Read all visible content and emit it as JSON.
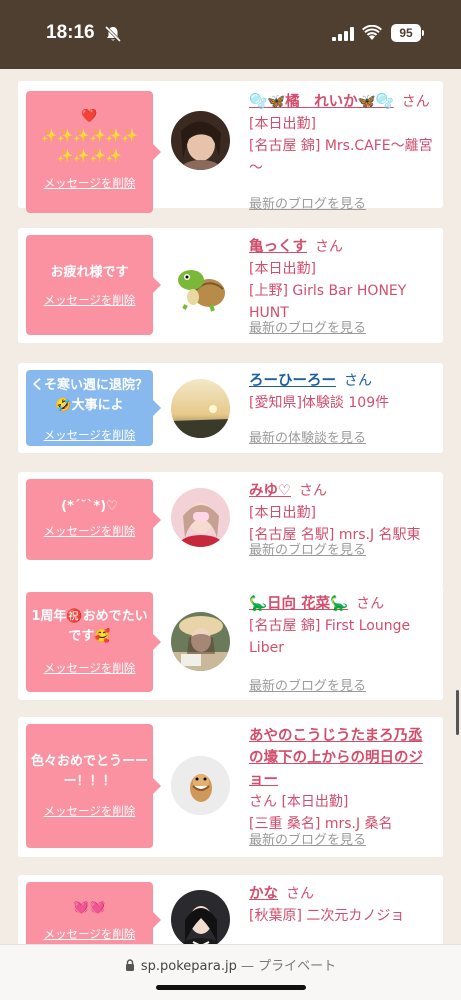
{
  "status_bar": {
    "time": "18:16",
    "battery": "95"
  },
  "url_bar": {
    "domain": "sp.pokepara.jp",
    "separator": "—",
    "mode": "プライベート"
  },
  "cards": [
    {
      "message": "❤️\n✨✨✨✨✨✨\n✨✨✨✨",
      "delete": "メッセージを削除",
      "name": "🫧🦋橘　れいか🦋🫧",
      "san": "さん",
      "detail": "[本日出勤]\n[名古屋 錦] Mrs.CAFE～離宮～",
      "link": "最新のブログを見る"
    },
    {
      "message": "お疲れ様です",
      "delete": "メッセージを削除",
      "name": "亀っくす",
      "san": "さん",
      "detail": "[本日出勤]\n[上野] Girls Bar HONEY HUNT",
      "link": "最新のブログを見る"
    },
    {
      "message": "くそ寒い週に退院？🤣大事によ",
      "delete": "メッセージを削除",
      "name": "ろーひーろー",
      "san": "さん",
      "detail": "[愛知県]体験談 109件",
      "link": "最新の体験談を見る"
    },
    {
      "message": "(*´˘`*)♡",
      "delete": "メッセージを削除",
      "name": "みゆ♡",
      "san": "さん",
      "detail": "[本日出勤]\n[名古屋 名駅] mrs.J 名駅東",
      "link": "最新のブログを見る"
    },
    {
      "message": "1周年㊗️おめでたいです🥰",
      "delete": "メッセージを削除",
      "name": "🦕日向 花菜🦕",
      "san": "さん",
      "detail": "[名古屋 錦] First Lounge Liber",
      "link": "最新のブログを見る"
    },
    {
      "message": "色々おめでとうーーー！！！",
      "delete": "メッセージを削除",
      "name": "あやのこうじうたまろ乃丞の壕下の上からの明日のジョー",
      "san": "さん",
      "detail": "[本日出勤]\n[三重 桑名] mrs.J 桑名",
      "link": "最新のブログを見る"
    },
    {
      "message": "💓💓",
      "delete": "メッセージを削除",
      "name": "かな",
      "san": "さん",
      "detail": "[秋葉原] 二次元カノジョ",
      "link": ""
    }
  ]
}
